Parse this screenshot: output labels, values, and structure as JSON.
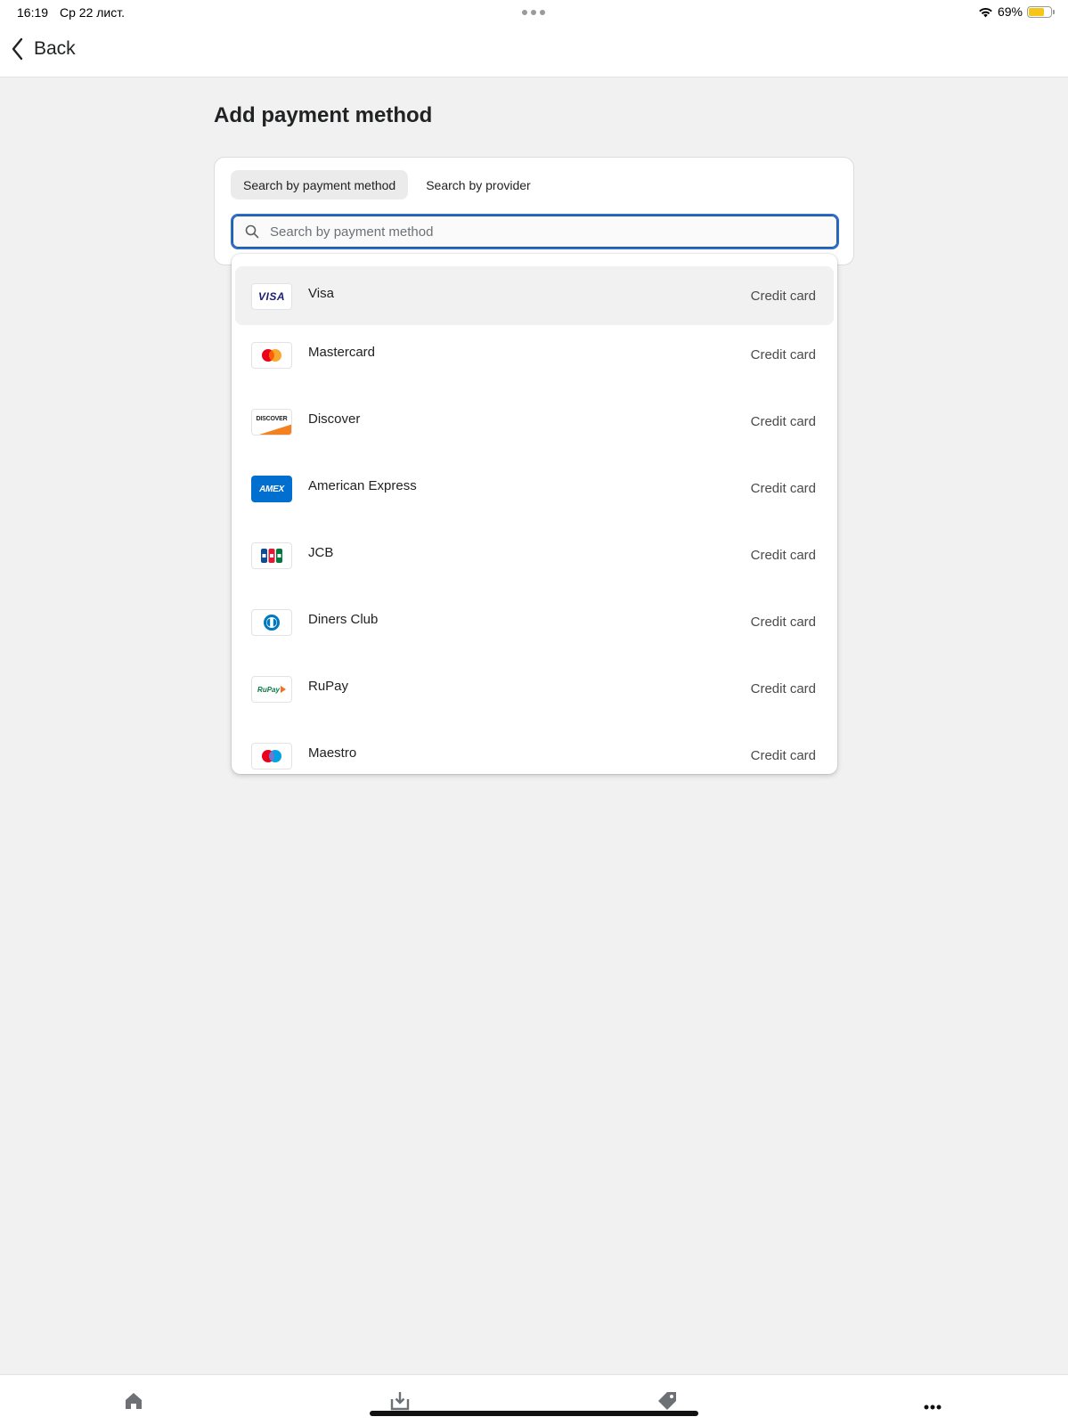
{
  "status_bar": {
    "time": "16:19",
    "date": "Ср 22 лист.",
    "battery": "69%",
    "battery_level": 0.69
  },
  "nav": {
    "back_label": "Back"
  },
  "page": {
    "title": "Add payment method"
  },
  "tabs": [
    {
      "label": "Search by payment method",
      "active": true
    },
    {
      "label": "Search by provider",
      "active": false
    }
  ],
  "search": {
    "placeholder": "Search by payment method",
    "value": ""
  },
  "options": [
    {
      "name": "Visa",
      "type": "Credit card",
      "icon": "visa-logo"
    },
    {
      "name": "Mastercard",
      "type": "Credit card",
      "icon": "mastercard-logo"
    },
    {
      "name": "Discover",
      "type": "Credit card",
      "icon": "discover-logo"
    },
    {
      "name": "American Express",
      "type": "Credit card",
      "icon": "amex-logo"
    },
    {
      "name": "JCB",
      "type": "Credit card",
      "icon": "jcb-logo"
    },
    {
      "name": "Diners Club",
      "type": "Credit card",
      "icon": "diners-club-logo"
    },
    {
      "name": "RuPay",
      "type": "Credit card",
      "icon": "rupay-logo"
    },
    {
      "name": "Maestro",
      "type": "Credit card",
      "icon": "maestro-logo"
    }
  ],
  "logo_text": {
    "visa": "VISA",
    "discover": "DISCOVER",
    "amex": "AMEX",
    "rupay": "RuPay"
  },
  "colors": {
    "accent": "#2c6ecb",
    "battery": "#f5c518",
    "amex": "#016fd0",
    "discover_orange": "#f48120",
    "visa_blue": "#1a1f71"
  },
  "bottom_bar": [
    "home-icon",
    "download-icon",
    "tag-icon",
    "more-icon"
  ]
}
